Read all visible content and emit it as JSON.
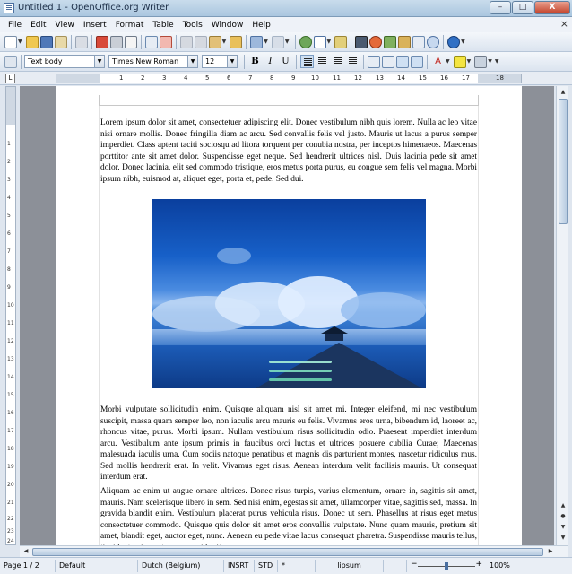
{
  "window": {
    "title": "Untitled 1 - OpenOffice.org Writer",
    "minimize": "–",
    "maximize": "□",
    "close": "X"
  },
  "menu": [
    "File",
    "Edit",
    "View",
    "Insert",
    "Format",
    "Table",
    "Tools",
    "Window",
    "Help"
  ],
  "menu_close": "×",
  "formatting": {
    "style": "Text body",
    "font": "Times New Roman",
    "size": "12",
    "bold": "B",
    "italic": "I",
    "underline": "U",
    "font_color_glyph": "A"
  },
  "ruler": {
    "ticks": [
      "1",
      "2",
      "3",
      "4",
      "5",
      "6",
      "7",
      "8",
      "9",
      "10",
      "11",
      "12",
      "13",
      "14",
      "15",
      "16",
      "17",
      "18"
    ]
  },
  "vruler": {
    "ticks": [
      "1",
      "2",
      "3",
      "4",
      "5",
      "6",
      "7",
      "8",
      "9",
      "10",
      "11",
      "12",
      "13",
      "14",
      "15",
      "16",
      "17",
      "18",
      "19",
      "20",
      "21",
      "22",
      "23",
      "24"
    ]
  },
  "document": {
    "paragraph1": "Lorem ipsum dolor sit amet, consectetuer adipiscing elit. Donec vestibulum nibh quis lorem. Nulla ac leo vitae nisi ornare mollis. Donec fringilla diam ac arcu. Sed convallis felis vel justo. Mauris ut lacus a purus semper imperdiet. Class aptent taciti sociosqu ad litora torquent per conubia nostra, per inceptos himenaeos. Maecenas porttitor ante sit amet dolor. Suspendisse eget neque. Sed hendrerit ultrices nisl. Duis lacinia pede sit amet dolor. Donec lacinia, elit sed commodo tristique, eros metus porta purus, eu congue sem felis vel magna. Morbi ipsum nibh, euismod at, aliquet eget, porta et, pede. Sed dui.",
    "paragraph2": "Morbi vulputate sollicitudin enim. Quisque aliquam nisl sit amet mi. Integer eleifend, mi nec vestibulum suscipit, massa quam semper leo, non iaculis arcu mauris eu felis. Vivamus eros urna, bibendum id, laoreet ac, rhoncus vitae, purus. Morbi ipsum. Nullam vestibulum risus sollicitudin odio. Praesent imperdiet interdum arcu. Vestibulum ante ipsum primis in faucibus orci luctus et ultrices posuere cubilia Curae; Maecenas malesuada iaculis urna. Cum sociis natoque penatibus et magnis dis parturient montes, nascetur ridiculus mus. Sed mollis hendrerit erat. In velit. Vivamus eget risus. Aenean interdum velit facilisis mauris. Ut consequat interdum erat.",
    "paragraph3": "Aliquam ac enim ut augue ornare ultrices. Donec risus turpis, varius elementum, ornare in, sagittis sit amet, mauris. Nam scelerisque libero in sem. Sed nisi enim, egestas sit amet, ullamcorper vitae, sagittis sed, massa. In gravida blandit enim. Vestibulum placerat purus vehicula risus. Donec ut sem. Phasellus at risus eget metus consectetuer commodo. Quisque quis dolor sit amet eros convallis vulputate. Nunc quam mauris, pretium sit amet, blandit eget, auctor eget, nunc. Aenean eu pede vitae lacus consequat pharetra. Suspendisse mauris tellus, tincidunt quis, porta nec, gravida sit"
  },
  "status": {
    "page": "Page 1 / 2",
    "page_style": "Default",
    "language": "Dutch (Belgium)",
    "insert_mode": "INSRT",
    "selection_mode": "STD",
    "modified": "*",
    "word": "lipsum",
    "zoom": "100%"
  }
}
